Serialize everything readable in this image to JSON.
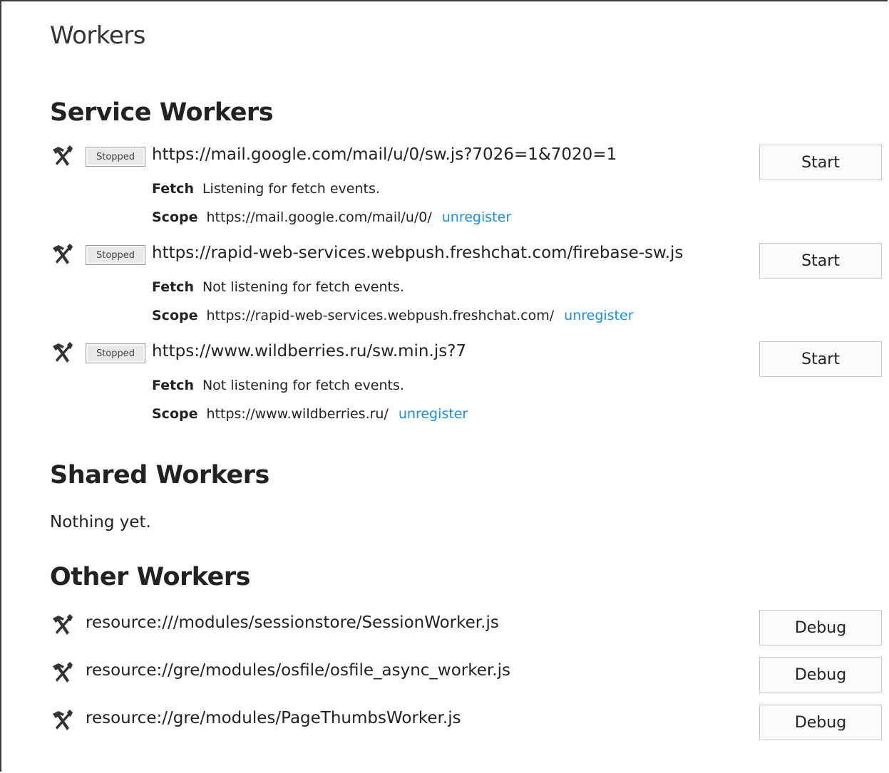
{
  "page": {
    "title": "Workers"
  },
  "service_workers": {
    "title": "Service Workers",
    "items": [
      {
        "status": "Stopped",
        "url": "https://mail.google.com/mail/u/0/sw.js?7026=1&7020=1",
        "fetch_label": "Fetch",
        "fetch_value": "Listening for fetch events.",
        "scope_label": "Scope",
        "scope_value": "https://mail.google.com/mail/u/0/",
        "unregister_label": "unregister",
        "button_label": "Start"
      },
      {
        "status": "Stopped",
        "url": "https://rapid-web-services.webpush.freshchat.com/firebase-sw.js",
        "fetch_label": "Fetch",
        "fetch_value": "Not listening for fetch events.",
        "scope_label": "Scope",
        "scope_value": "https://rapid-web-services.webpush.freshchat.com/",
        "unregister_label": "unregister",
        "button_label": "Start"
      },
      {
        "status": "Stopped",
        "url": "https://www.wildberries.ru/sw.min.js?7",
        "fetch_label": "Fetch",
        "fetch_value": "Not listening for fetch events.",
        "scope_label": "Scope",
        "scope_value": "https://www.wildberries.ru/",
        "unregister_label": "unregister",
        "button_label": "Start"
      }
    ]
  },
  "shared_workers": {
    "title": "Shared Workers",
    "empty_text": "Nothing yet."
  },
  "other_workers": {
    "title": "Other Workers",
    "items": [
      {
        "url": "resource:///modules/sessionstore/SessionWorker.js",
        "button_label": "Debug"
      },
      {
        "url": "resource://gre/modules/osfile/osfile_async_worker.js",
        "button_label": "Debug"
      },
      {
        "url": "resource://gre/modules/PageThumbsWorker.js",
        "button_label": "Debug"
      }
    ]
  },
  "icons": {
    "worker": "debug-tools-icon"
  },
  "colors": {
    "link": "#1a8ee8",
    "text": "#222222"
  }
}
